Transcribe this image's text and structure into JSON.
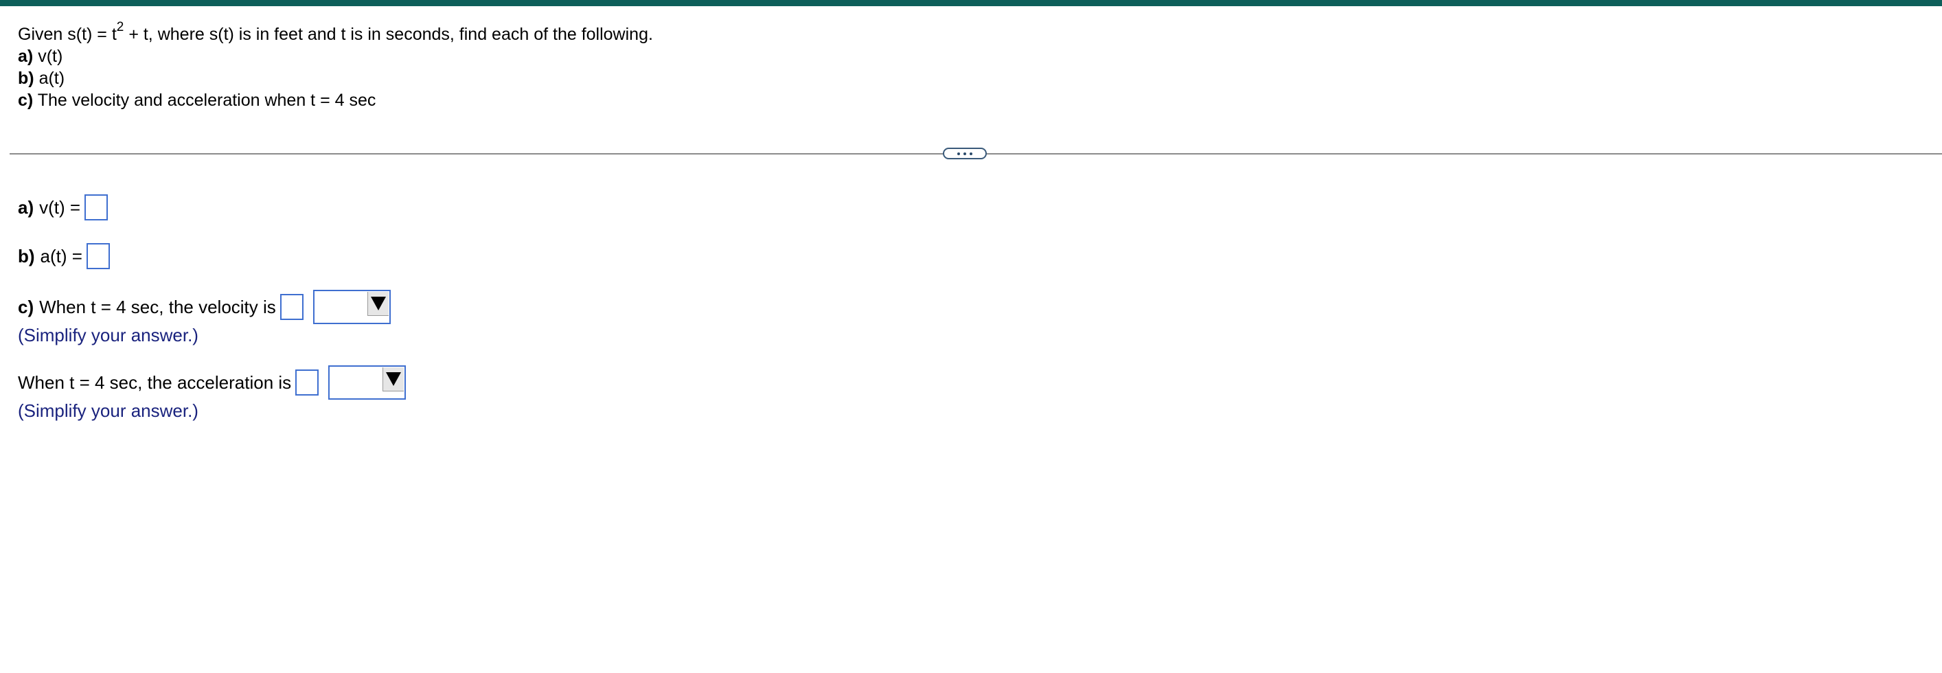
{
  "colors": {
    "top_bar": "#0d5f5a",
    "hint_text": "#1a237e",
    "input_border": "#3f6fd0"
  },
  "question": {
    "intro_prefix": "Given s(t) = t",
    "intro_exponent": "2",
    "intro_suffix": " + t, where s(t) is in feet and t is in seconds, find each of the following.",
    "part_a_label": "a)",
    "part_a_text": "v(t)",
    "part_b_label": "b)",
    "part_b_text": "a(t)",
    "part_c_label": "c)",
    "part_c_text": "The velocity and acceleration when t = 4 sec"
  },
  "more_button_icon": "ellipsis-icon",
  "answers": {
    "a_label": "a)",
    "a_text": "v(t) =",
    "a_value": "",
    "b_label": "b)",
    "b_text": "a(t) =",
    "b_value": "",
    "c_label": "c)",
    "c_text": "When t = 4 sec, the velocity is",
    "c_value": "",
    "c_unit_selected": "",
    "c_hint": "(Simplify your answer.)",
    "d_text": "When t = 4 sec, the acceleration is",
    "d_value": "",
    "d_unit_selected": "",
    "d_hint": "(Simplify your answer.)",
    "dropdown_icon": "triangle-down-icon"
  }
}
